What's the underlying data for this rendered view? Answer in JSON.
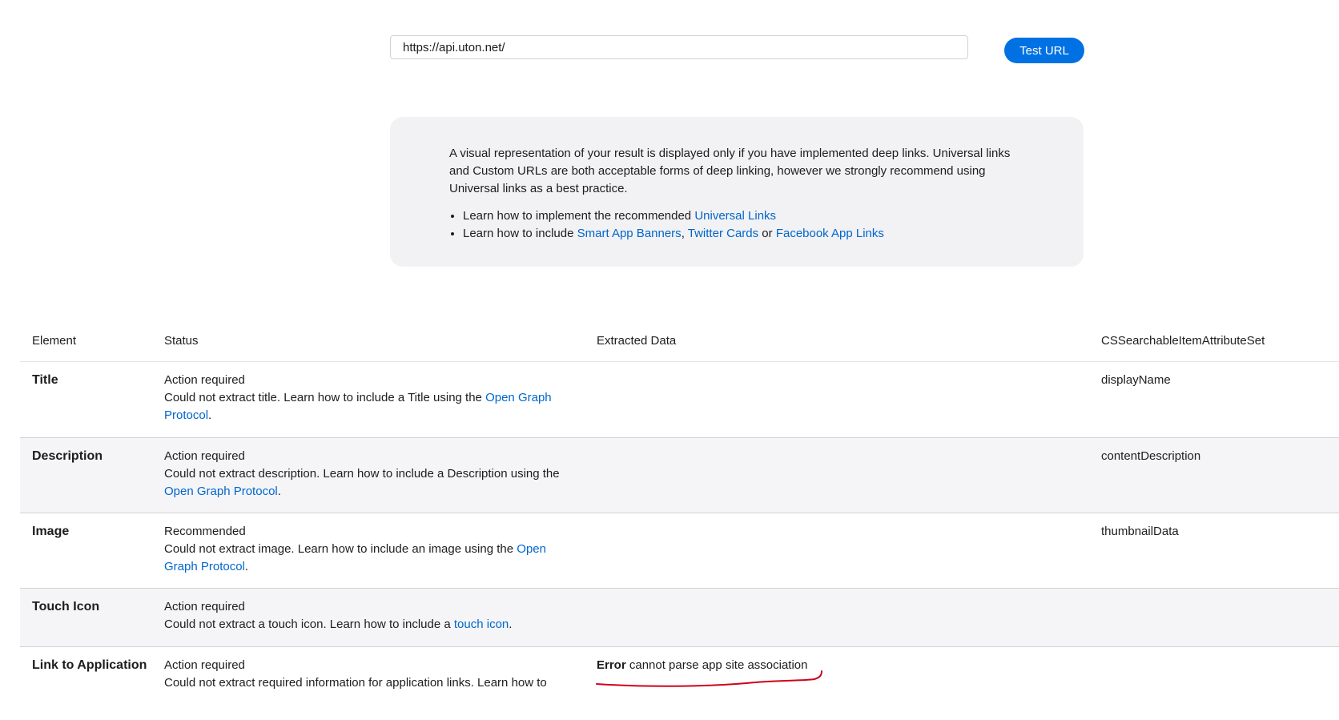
{
  "url_bar": {
    "value": "https://api.uton.net/",
    "button_label": "Test URL"
  },
  "info": {
    "paragraph": "A visual representation of your result is displayed only if you have implemented deep links. Universal links and Custom URLs are both acceptable forms of deep linking, however we strongly recommend using Universal links as a best practice.",
    "bullet1_prefix": "Learn how to implement the recommended ",
    "bullet1_link": "Universal Links",
    "bullet2_prefix": "Learn how to include ",
    "bullet2_link1": "Smart App Banners",
    "bullet2_sep1": ", ",
    "bullet2_link2": "Twitter Cards",
    "bullet2_sep2": " or ",
    "bullet2_link3": "Facebook App Links"
  },
  "table": {
    "headers": {
      "element": "Element",
      "status": "Status",
      "extracted": "Extracted Data",
      "cs": "CSSearchableItemAttributeSet"
    },
    "rows": [
      {
        "element": "Title",
        "status": "Action required",
        "desc_prefix": "Could not extract title. Learn how to include a Title using the ",
        "desc_link": "Open Graph Protocol",
        "desc_suffix": ".",
        "cs": "displayName"
      },
      {
        "element": "Description",
        "status": "Action required",
        "desc_prefix": "Could not extract description. Learn how to include a Description using the ",
        "desc_link": "Open Graph Protocol",
        "desc_suffix": ".",
        "cs": "contentDescription"
      },
      {
        "element": "Image",
        "status": "Recommended",
        "desc_prefix": "Could not extract image. Learn how to include an image using the ",
        "desc_link": "Open Graph Protocol",
        "desc_suffix": ".",
        "cs": "thumbnailData"
      },
      {
        "element": "Touch Icon",
        "status": "Action required",
        "desc_prefix": "Could not extract a touch icon. Learn how to include a ",
        "desc_link": "touch icon",
        "desc_suffix": ".",
        "cs": ""
      },
      {
        "element": "Link to Application",
        "status": "Action required",
        "desc_prefix": "Could not extract required information for application links. Learn how to",
        "error_label": "Error",
        "error_text": " cannot parse app site association",
        "cs": ""
      }
    ]
  },
  "colors": {
    "accent": "#0071e3",
    "link": "#0066cc",
    "annotation": "#d0021b",
    "info_bg": "#f2f2f4",
    "row_alt_bg": "#f5f5f7"
  }
}
